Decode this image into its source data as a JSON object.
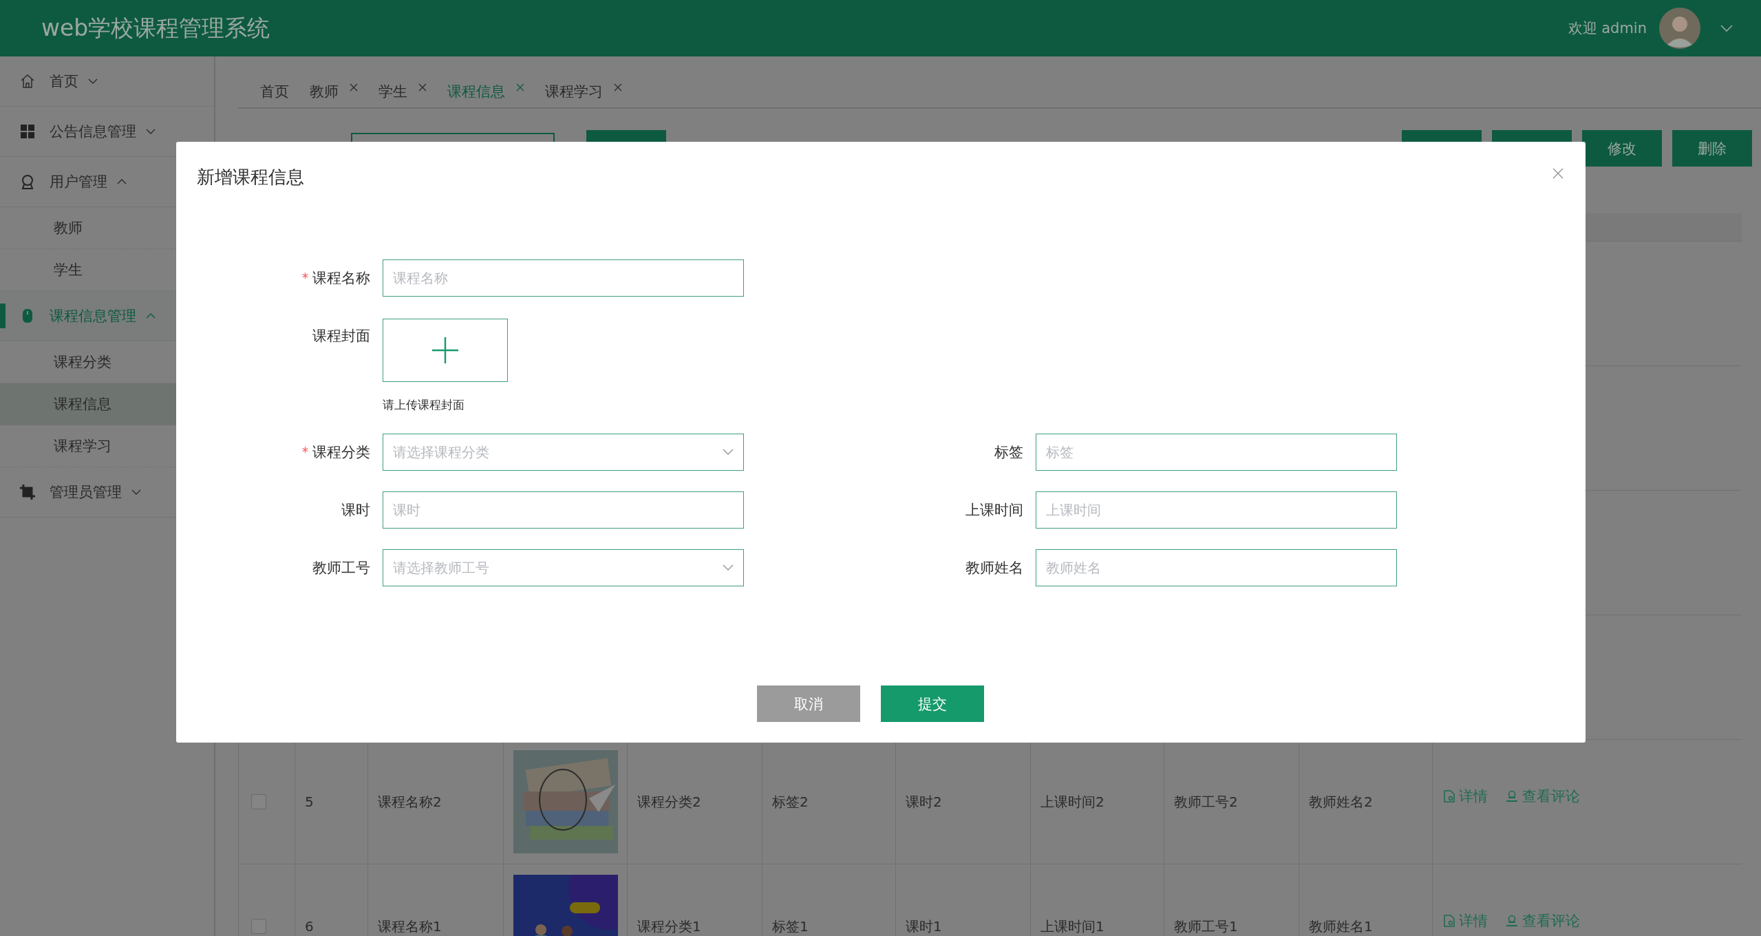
{
  "header": {
    "title": "web学校课程管理系统",
    "greeting": "欢迎 admin"
  },
  "sidebar": {
    "items": [
      {
        "label": "首页",
        "expanded": false,
        "selected": false
      },
      {
        "label": "公告信息管理",
        "expanded": false,
        "selected": false
      },
      {
        "label": "用户管理",
        "expanded": true,
        "selected": false,
        "children": [
          {
            "label": "教师",
            "selected": false
          },
          {
            "label": "学生",
            "selected": false
          }
        ]
      },
      {
        "label": "课程信息管理",
        "expanded": true,
        "selected": true,
        "children": [
          {
            "label": "课程分类",
            "selected": false
          },
          {
            "label": "课程信息",
            "selected": true
          },
          {
            "label": "课程学习",
            "selected": false
          }
        ]
      },
      {
        "label": "管理员管理",
        "expanded": false,
        "selected": false
      }
    ]
  },
  "tabs": [
    {
      "label": "首页",
      "closable": false,
      "selected": false
    },
    {
      "label": "教师",
      "closable": true,
      "selected": false
    },
    {
      "label": "学生",
      "closable": true,
      "selected": false
    },
    {
      "label": "课程信息",
      "closable": true,
      "selected": true
    },
    {
      "label": "课程学习",
      "closable": true,
      "selected": false
    }
  ],
  "toolbar": {
    "buttons": [
      {
        "label": "修改"
      },
      {
        "label": "删除"
      }
    ]
  },
  "table": {
    "rows": [
      {
        "checked": false,
        "index": "5",
        "name": "课程名称2",
        "cover": {
          "kind": "picture"
        },
        "category": "课程分类2",
        "tag": "标签2",
        "hours": "课时2",
        "time": "上课时间2",
        "teacher_no": "教师工号2",
        "teacher_name": "教师姓名2",
        "actions": [
          "详情",
          "查看评论"
        ]
      },
      {
        "checked": false,
        "index": "6",
        "name": "课程名称1",
        "cover": {
          "kind": "picture"
        },
        "category": "课程分类1",
        "tag": "标签1",
        "hours": "课时1",
        "time": "上课时间1",
        "teacher_no": "教师工号1",
        "teacher_name": "教师姓名1",
        "actions": [
          "详情",
          "查看评论"
        ]
      }
    ]
  },
  "modal": {
    "title": "新增课程信息",
    "rows": [
      [
        {
          "label": "课程名称",
          "kind": "input",
          "required": true,
          "placeholder": "课程名称"
        }
      ],
      [
        {
          "label": "课程封面",
          "kind": "upload",
          "required": false,
          "hint": "请上传课程封面"
        }
      ],
      [
        {
          "label": "课程分类",
          "kind": "select",
          "required": true,
          "placeholder": "请选择课程分类"
        },
        {
          "label": "标签",
          "kind": "input",
          "required": false,
          "placeholder": "标签"
        }
      ],
      [
        {
          "label": "课时",
          "kind": "input",
          "required": false,
          "placeholder": "课时"
        },
        {
          "label": "上课时间",
          "kind": "input",
          "required": false,
          "placeholder": "上课时间"
        }
      ],
      [
        {
          "label": "教师工号",
          "kind": "select",
          "required": false,
          "placeholder": "请选择教师工号"
        },
        {
          "label": "教师姓名",
          "kind": "input",
          "required": false,
          "placeholder": "教师姓名"
        }
      ]
    ],
    "buttons": [
      {
        "label": "取消",
        "kind": "cancel"
      },
      {
        "label": "提交",
        "kind": "primary"
      }
    ]
  }
}
